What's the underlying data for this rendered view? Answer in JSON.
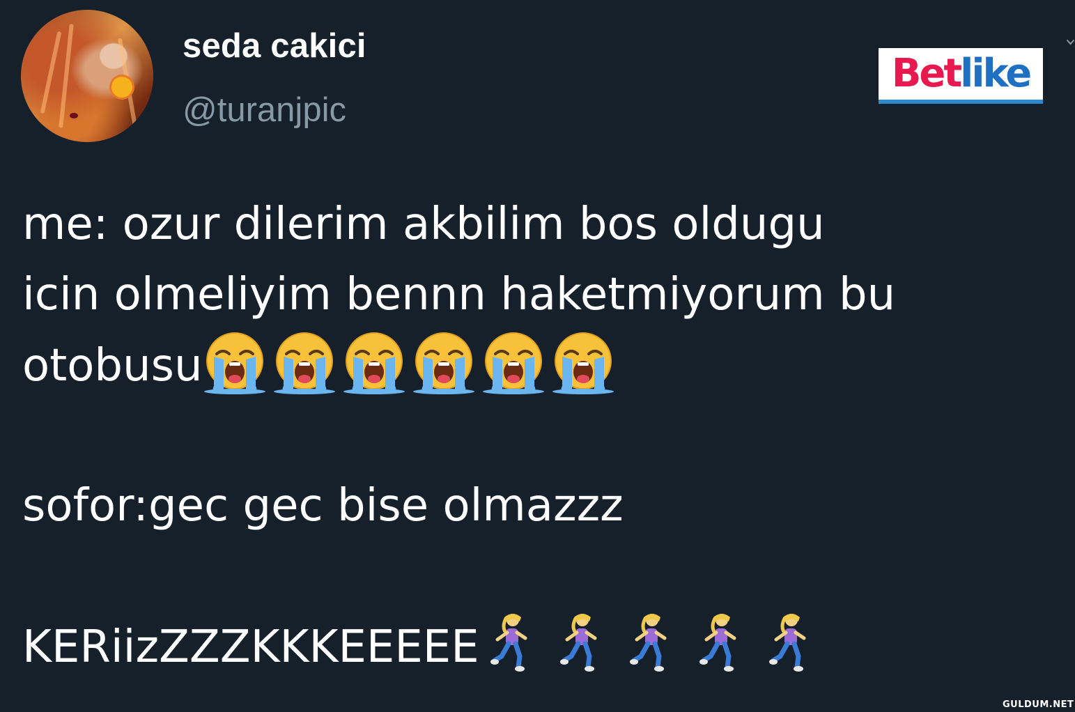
{
  "tweet": {
    "author": {
      "display_name": "seda cakici",
      "handle": "@turanjpic",
      "avatar_icon": "profile-photo"
    },
    "text_lines": [
      "me: ozur dilerim akbilim bos oldugu",
      "icin olmeliyim bennn haketmiyorum bu",
      "otobusu",
      "sofor:gec gec bise olmazzz",
      "KERiizZZZKKKEEEEE"
    ],
    "emojis": {
      "crying_face_count": 6,
      "crying_face_icon": "loudly-crying-face-icon",
      "runner_count": 5,
      "runner_icon": "woman-running-icon"
    },
    "menu_icon": "chevron-down-icon"
  },
  "logo": {
    "part_a": "Bet",
    "part_b": "like"
  },
  "watermark": "GULDUM.NET",
  "colors": {
    "background": "#15202b",
    "text_primary": "#ffffff",
    "text_secondary": "#8899a6",
    "logo_red": "#e8194f",
    "logo_blue": "#1f6fc2"
  }
}
